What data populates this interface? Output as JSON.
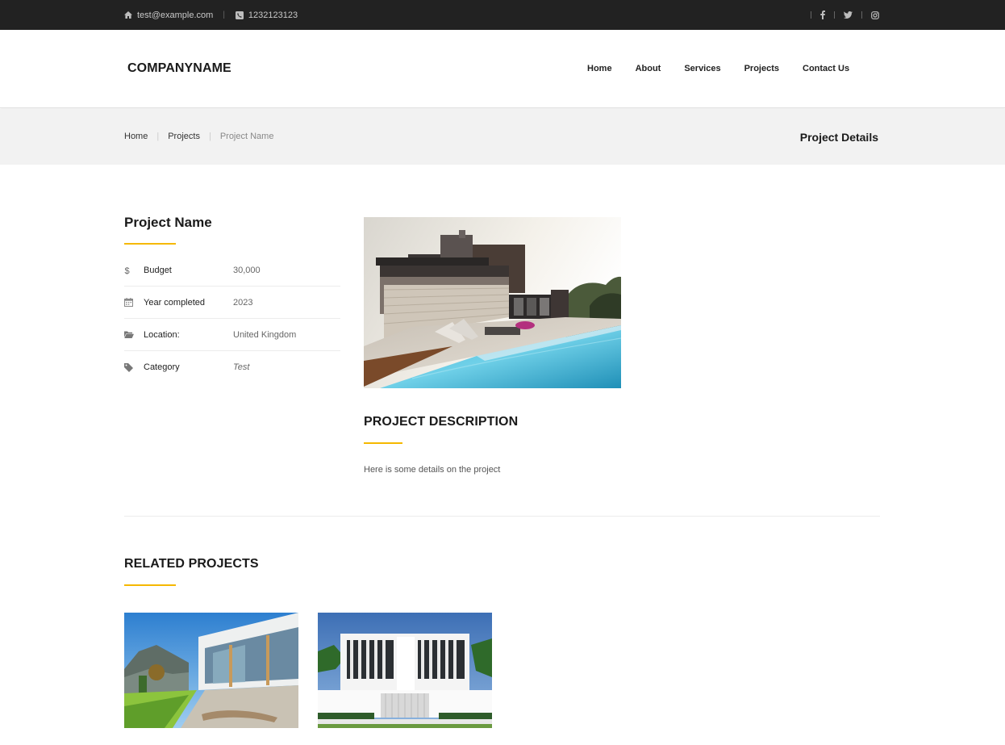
{
  "topbar": {
    "email": "test@example.com",
    "phone": "1232123123",
    "social": [
      "facebook-icon",
      "twitter-icon",
      "instagram-icon"
    ]
  },
  "header": {
    "brand": "COMPANYNAME",
    "nav": [
      "Home",
      "About",
      "Services",
      "Projects",
      "Contact Us"
    ]
  },
  "breadcrumb": {
    "items": [
      "Home",
      "Projects",
      "Project Name"
    ],
    "page_heading": "Project Details"
  },
  "project": {
    "name": "Project Name",
    "details": [
      {
        "icon": "dollar-icon",
        "label": "Budget",
        "value": "30,000"
      },
      {
        "icon": "calendar-icon",
        "label": "Year completed",
        "value": "2023"
      },
      {
        "icon": "folder-icon",
        "label": "Location:",
        "value": "United Kingdom"
      },
      {
        "icon": "tag-icon",
        "label": "Category",
        "value": "Test"
      }
    ],
    "description_title": "PROJECT DESCRIPTION",
    "description_text": "Here is some details on the project"
  },
  "related": {
    "title": "RELATED PROJECTS"
  },
  "colors": {
    "topbar_bg": "#222222",
    "accent": "#f5b800",
    "breadcrumb_bg": "#f2f2f2"
  }
}
